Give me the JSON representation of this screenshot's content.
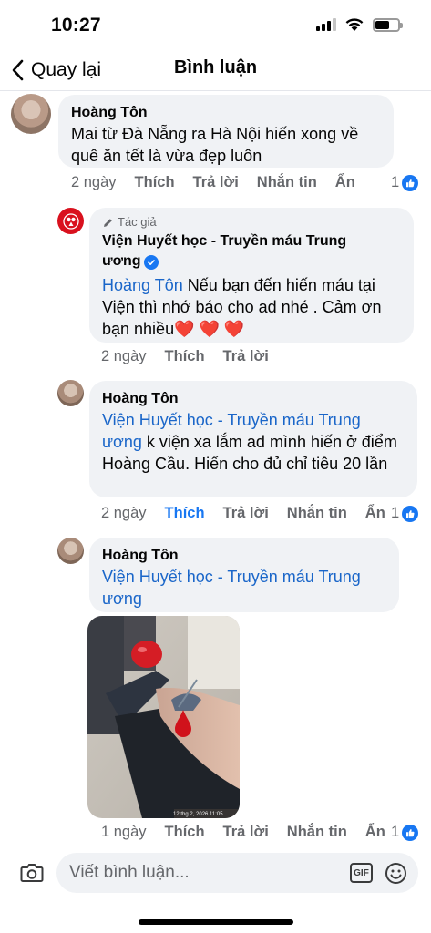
{
  "status_bar": {
    "time": "10:27",
    "battery_level": 0.62
  },
  "nav": {
    "back_label": "Quay lại",
    "title": "Bình luận"
  },
  "comments": [
    {
      "author": "Hoàng Tôn",
      "text": "Mai từ Đà Nẵng ra Hà Nội hiến xong về quê ăn tết là vừa đẹp luôn",
      "time": "2 ngày",
      "actions": [
        "Thích",
        "Trả lời",
        "Nhắn tin",
        "Ẩn"
      ],
      "like_count": "1"
    },
    {
      "author_tag": "Tác giả",
      "author": "Viện Huyết học - Truyền máu Trung ương",
      "mention": "Hoàng Tôn",
      "text": " Nếu bạn đến hiến máu tại Viện thì nhớ báo cho ad nhé . Cảm ơn bạn nhiều",
      "hearts": "❤️ ❤️ ❤️",
      "time": "2 ngày",
      "actions": [
        "Thích",
        "Trả lời"
      ]
    },
    {
      "author": "Hoàng Tôn",
      "mention": "Viện Huyết học - Truyền máu Trung ương",
      "text": " k viện xa lắm ad mình hiến ở điểm Hoàng Cầu. Hiến cho đủ chỉ tiêu 20 lần",
      "time": "2 ngày",
      "actions": [
        "Thích",
        "Trả lời",
        "Nhắn tin",
        "Ẩn"
      ],
      "like_count": "1"
    },
    {
      "author": "Hoàng Tôn",
      "mention": "Viện Huyết học - Truyền máu Trung ương",
      "photo_timestamp": "12 thg 2, 2026 11:05",
      "time": "1 ngày",
      "actions": [
        "Thích",
        "Trả lời",
        "Nhắn tin",
        "Ẩn"
      ],
      "like_count": "1"
    }
  ],
  "composer": {
    "placeholder": "Viết bình luận...",
    "gif_label": "GIF"
  },
  "colors": {
    "accent": "#1877f2",
    "link": "#1a66c9",
    "bubble": "#f0f2f5",
    "muted": "#65676b",
    "heart": "#e0245e"
  }
}
